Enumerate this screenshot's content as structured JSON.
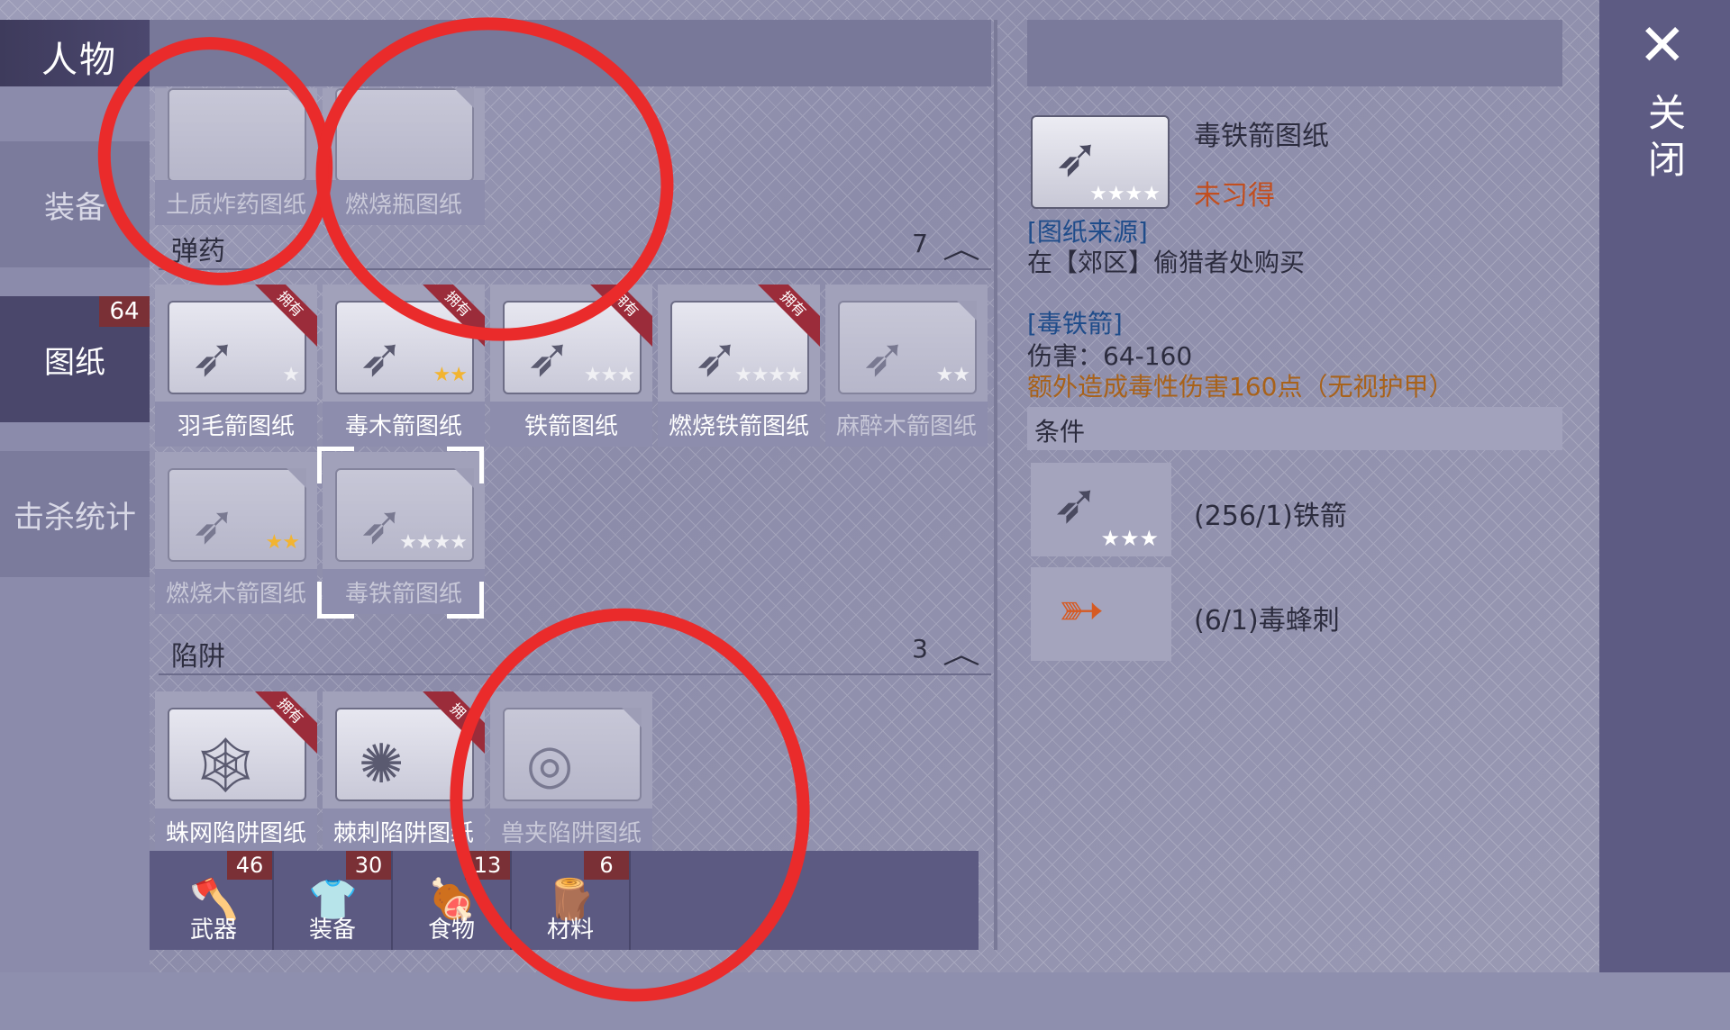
{
  "header": {
    "title": "人物",
    "close_label": "关闭"
  },
  "sidebar": {
    "items": [
      {
        "label": "装备",
        "active": false
      },
      {
        "label": "图纸",
        "active": true,
        "badge": "64"
      },
      {
        "label": "击杀统计",
        "active": false
      }
    ]
  },
  "blueprints": {
    "top_row": [
      {
        "label": "土质炸药图纸",
        "owned": false
      },
      {
        "label": "燃烧瓶图纸",
        "owned": false
      }
    ],
    "ammo": {
      "title": "弹药",
      "count": "7",
      "items": [
        {
          "label": "羽毛箭图纸",
          "owned": true,
          "owned_tag": "拥有",
          "stars": "★"
        },
        {
          "label": "毒木箭图纸",
          "owned": true,
          "owned_tag": "拥有",
          "stars": "★★"
        },
        {
          "label": "铁箭图纸",
          "owned": true,
          "owned_tag": "拥有",
          "stars": "★★★"
        },
        {
          "label": "燃烧铁箭图纸",
          "owned": true,
          "owned_tag": "拥有",
          "stars": "★★★★"
        },
        {
          "label": "麻醉木箭图纸",
          "owned": false,
          "stars": "★★"
        },
        {
          "label": "燃烧木箭图纸",
          "owned": false,
          "stars": "★★"
        },
        {
          "label": "毒铁箭图纸",
          "owned": false,
          "selected": true,
          "stars": "★★★★"
        }
      ]
    },
    "traps": {
      "title": "陷阱",
      "count": "3",
      "items": [
        {
          "label": "蛛网陷阱图纸",
          "owned": true,
          "owned_tag": "拥有"
        },
        {
          "label": "棘刺陷阱图纸",
          "owned": true,
          "owned_tag": "拥"
        },
        {
          "label": "兽夹陷阱图纸",
          "owned": false
        }
      ]
    }
  },
  "bottom_tabs": [
    {
      "label": "武器",
      "badge": "46",
      "icon": "axe-icon"
    },
    {
      "label": "装备",
      "badge": "30",
      "icon": "shirt-icon"
    },
    {
      "label": "食物",
      "badge": "13",
      "icon": "meat-icon"
    },
    {
      "label": "材料",
      "badge": "6",
      "icon": "wood-icon"
    }
  ],
  "detail": {
    "name": "毒铁箭图纸",
    "status": "未习得",
    "source_title": "[图纸来源]",
    "source_text": "在【郊区】偷猎者处购买",
    "item_title": "[毒铁箭]",
    "damage": "伤害：64-160",
    "extra": "额外造成毒性伤害160点（无视护甲）",
    "conditions_title": "条件",
    "conditions": [
      {
        "text": "(256/1)铁箭",
        "stars": "★★★"
      },
      {
        "text": "(6/1)毒蜂刺"
      }
    ],
    "icon_stars": "★★★★"
  },
  "colors": {
    "accent": "#5d5b83",
    "owned_ribbon": "#9b2c3a",
    "status_red": "#c24e1e",
    "link_blue": "#1f4c8a",
    "annotation_red": "#ea2b2b"
  }
}
